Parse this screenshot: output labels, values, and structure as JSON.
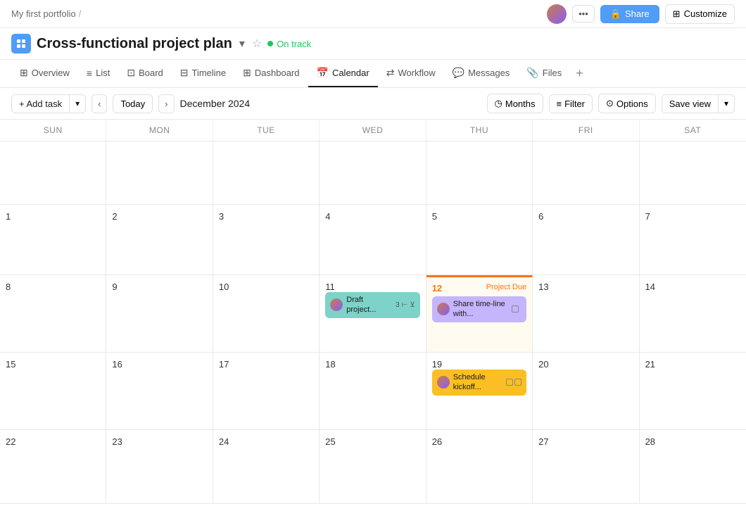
{
  "topbar": {
    "portfolio": "My first portfolio",
    "separator": "/",
    "more_label": "•••",
    "share_label": "Share",
    "customize_label": "Customize"
  },
  "project": {
    "title": "Cross-functional project plan",
    "status": "On track",
    "status_color": "#22c55e"
  },
  "nav": {
    "tabs": [
      {
        "id": "overview",
        "label": "Overview",
        "icon": "⊞"
      },
      {
        "id": "list",
        "label": "List",
        "icon": "≡"
      },
      {
        "id": "board",
        "label": "Board",
        "icon": "⊡"
      },
      {
        "id": "timeline",
        "label": "Timeline",
        "icon": "⊟"
      },
      {
        "id": "dashboard",
        "label": "Dashboard",
        "icon": "⊞"
      },
      {
        "id": "calendar",
        "label": "Calendar",
        "icon": "📅",
        "active": true
      },
      {
        "id": "workflow",
        "label": "Workflow",
        "icon": "⇄"
      },
      {
        "id": "messages",
        "label": "Messages",
        "icon": "💬"
      },
      {
        "id": "files",
        "label": "Files",
        "icon": "📎"
      }
    ]
  },
  "toolbar": {
    "add_task_label": "+ Add task",
    "today_label": "Today",
    "month_display": "December 2024",
    "months_label": "Months",
    "filter_label": "Filter",
    "options_label": "Options",
    "save_view_label": "Save view"
  },
  "calendar": {
    "day_headers": [
      "SUN",
      "MON",
      "TUE",
      "WED",
      "THU",
      "FRI",
      "SAT"
    ],
    "weeks": [
      [
        {
          "day": "",
          "empty": true
        },
        {
          "day": "",
          "empty": true
        },
        {
          "day": "",
          "empty": true
        },
        {
          "day": "",
          "empty": true
        },
        {
          "day": "",
          "empty": true
        },
        {
          "day": "",
          "empty": true
        },
        {
          "day": "",
          "empty": true
        }
      ],
      [
        {
          "day": "1",
          "empty": true
        },
        {
          "day": "2",
          "empty": true
        },
        {
          "day": "3",
          "empty": true
        },
        {
          "day": "4",
          "empty": true
        },
        {
          "day": "5",
          "empty": true
        },
        {
          "day": "6",
          "empty": true
        },
        {
          "day": "7",
          "empty": true
        }
      ],
      [
        {
          "day": "8"
        },
        {
          "day": "9"
        },
        {
          "day": "10"
        },
        {
          "day": "11",
          "tasks": [
            "draft"
          ]
        },
        {
          "day": "12",
          "today": true,
          "project_due": true,
          "tasks": [
            "share"
          ]
        },
        {
          "day": "13"
        },
        {
          "day": "14"
        }
      ],
      [
        {
          "day": "15"
        },
        {
          "day": "16"
        },
        {
          "day": "17"
        },
        {
          "day": "18"
        },
        {
          "day": "19",
          "tasks": [
            "schedule"
          ]
        },
        {
          "day": "20"
        },
        {
          "day": "21"
        }
      ],
      [
        {
          "day": "22"
        },
        {
          "day": "23"
        },
        {
          "day": "24"
        },
        {
          "day": "25"
        },
        {
          "day": "26"
        },
        {
          "day": "27"
        },
        {
          "day": "28"
        }
      ]
    ],
    "tasks": {
      "draft": {
        "text": "Draft project...",
        "color": "teal",
        "count": "3",
        "has_subtask": true,
        "has_pin": true
      },
      "share": {
        "text": "Share time-line with...",
        "color": "purple",
        "has_icons": true
      },
      "schedule": {
        "text": "Schedule kickoff...",
        "color": "yellow",
        "has_icons": true
      }
    },
    "project_due_label": "Project Due"
  }
}
